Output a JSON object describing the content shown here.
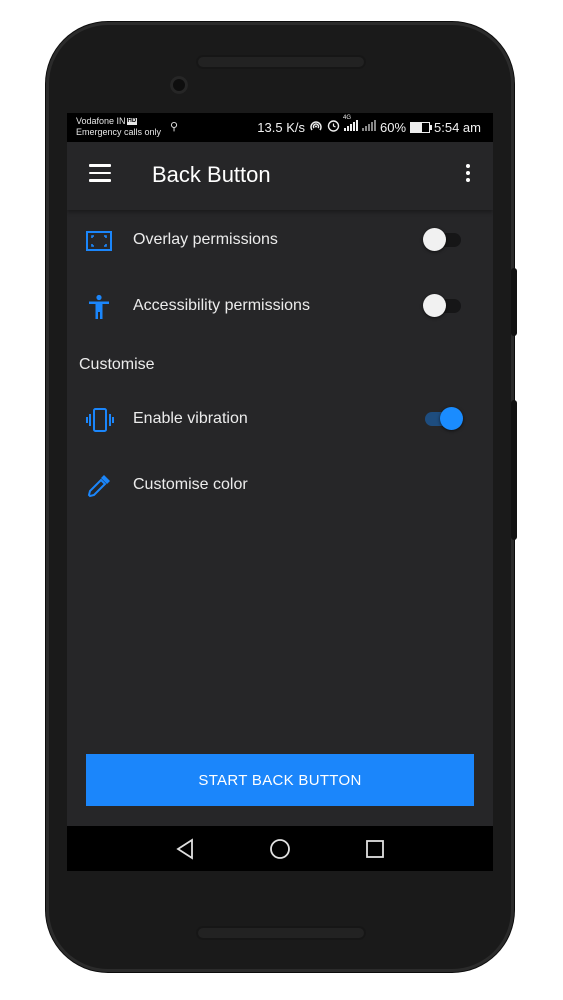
{
  "status_bar": {
    "carrier": "Vodafone IN",
    "carrier_badge": "HD",
    "emergency": "Emergency calls only",
    "speed": "13.5 K/s",
    "network": "4G",
    "battery": "60%",
    "battery_level": 0.6,
    "time": "5:54 am"
  },
  "app_bar": {
    "title": "Back Button"
  },
  "settings": {
    "overlay": {
      "label": "Overlay permissions",
      "icon": "overlay-icon",
      "enabled": false
    },
    "accessibility": {
      "label": "Accessibility permissions",
      "icon": "accessibility-icon",
      "enabled": false
    },
    "section_title": "Customise",
    "vibration": {
      "label": "Enable vibration",
      "icon": "vibration-icon",
      "enabled": true
    },
    "color": {
      "label": "Customise color",
      "icon": "eyedropper-icon"
    }
  },
  "primary_action": {
    "label": "START BACK BUTTON"
  },
  "colors": {
    "accent": "#1b86fb",
    "background": "#262628",
    "toggle_on": "#1a8cff"
  }
}
